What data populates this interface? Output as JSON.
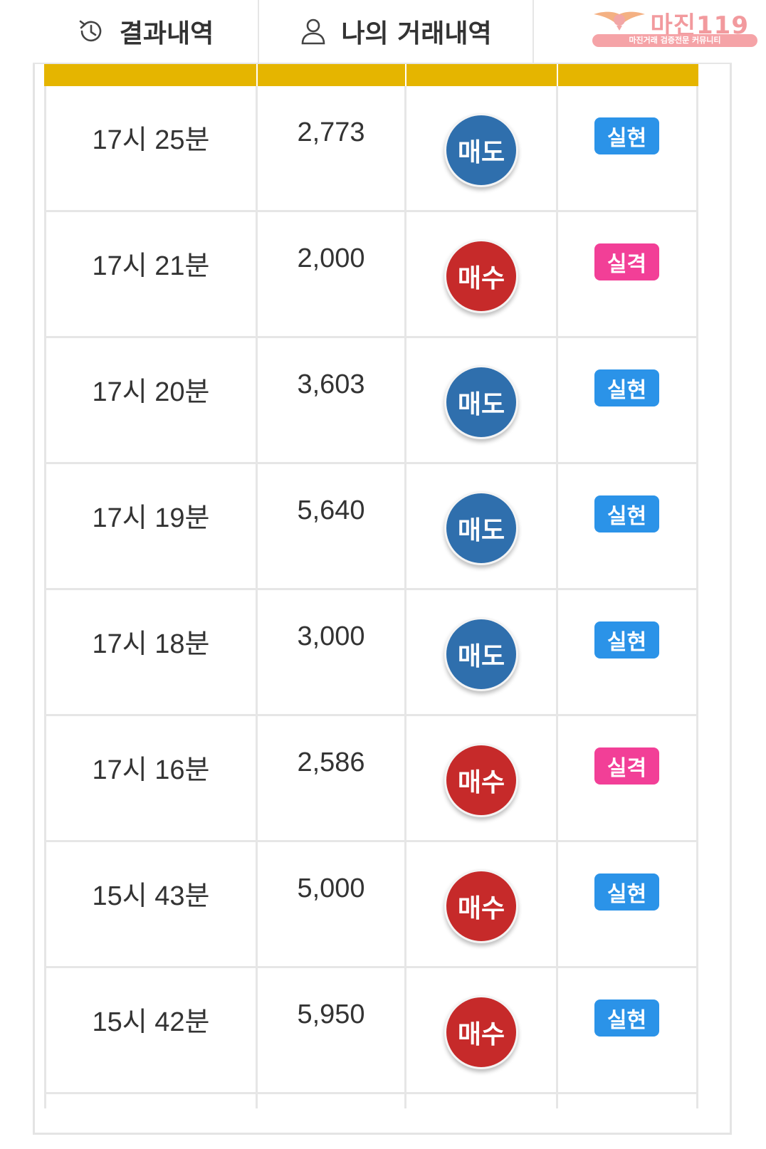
{
  "tabs": {
    "results_label": "결과내역",
    "my_trades_label": "나의 거래내역"
  },
  "logo": {
    "title": "마진119",
    "subtitle": "마진거래 검증전문 커뮤니티"
  },
  "colors": {
    "header_bar": "#e5b500",
    "sell": "#2f6fad",
    "buy": "#c62a2a",
    "success": "#2b93e8",
    "fail": "#f23f97"
  },
  "rows": [
    {
      "time": "17시 25분",
      "amount": "2,773",
      "side": "매도",
      "side_type": "sell",
      "result": "실현",
      "result_type": "success"
    },
    {
      "time": "17시 21분",
      "amount": "2,000",
      "side": "매수",
      "side_type": "buy",
      "result": "실격",
      "result_type": "fail"
    },
    {
      "time": "17시 20분",
      "amount": "3,603",
      "side": "매도",
      "side_type": "sell",
      "result": "실현",
      "result_type": "success"
    },
    {
      "time": "17시 19분",
      "amount": "5,640",
      "side": "매도",
      "side_type": "sell",
      "result": "실현",
      "result_type": "success"
    },
    {
      "time": "17시 18분",
      "amount": "3,000",
      "side": "매도",
      "side_type": "sell",
      "result": "실현",
      "result_type": "success"
    },
    {
      "time": "17시 16분",
      "amount": "2,586",
      "side": "매수",
      "side_type": "buy",
      "result": "실격",
      "result_type": "fail"
    },
    {
      "time": "15시 43분",
      "amount": "5,000",
      "side": "매수",
      "side_type": "buy",
      "result": "실현",
      "result_type": "success"
    },
    {
      "time": "15시 42분",
      "amount": "5,950",
      "side": "매수",
      "side_type": "buy",
      "result": "실현",
      "result_type": "success"
    }
  ]
}
